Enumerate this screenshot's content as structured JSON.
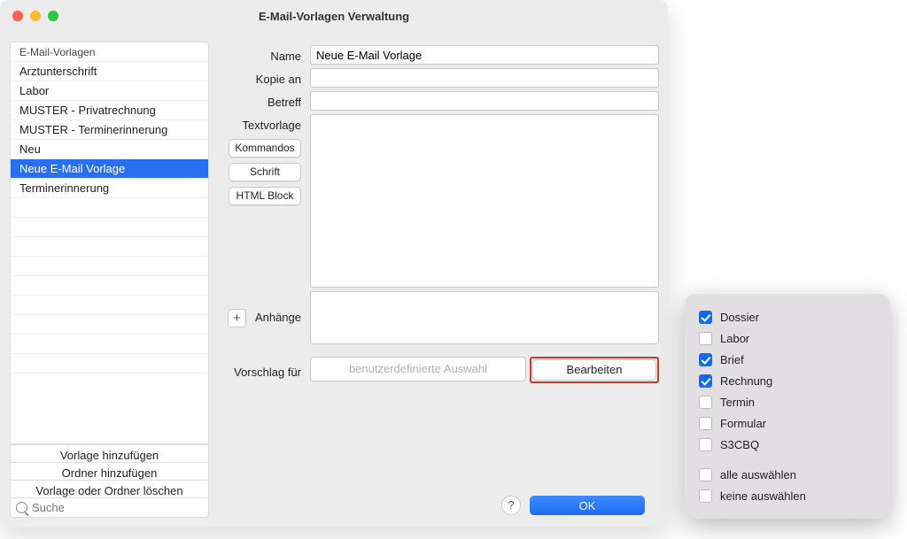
{
  "window": {
    "title": "E-Mail-Vorlagen Verwaltung"
  },
  "sidebar": {
    "folder": "E-Mail-Vorlagen",
    "templates": [
      {
        "label": "Arztunterschrift",
        "selected": false
      },
      {
        "label": "Labor",
        "selected": false
      },
      {
        "label": "MUSTER - Privatrechnung",
        "selected": false
      },
      {
        "label": "MUSTER - Terminerinnerung",
        "selected": false
      },
      {
        "label": "Neu",
        "selected": false
      },
      {
        "label": "Neue E-Mail Vorlage",
        "selected": true
      },
      {
        "label": "Terminerinnerung",
        "selected": false
      }
    ],
    "actions": {
      "add_template": "Vorlage hinzufügen",
      "add_folder": "Ordner hinzufügen",
      "delete": "Vorlage oder Ordner löschen"
    },
    "search_placeholder": "Suche"
  },
  "form": {
    "labels": {
      "name": "Name",
      "copy_to": "Kopie an",
      "subject": "Betreff",
      "texttemplate": "Textvorlage",
      "attachments": "Anhänge",
      "suggestion_for": "Vorschlag für"
    },
    "values": {
      "name": "Neue E-Mail Vorlage",
      "copy_to": "",
      "subject": "",
      "suggestion_text": "benutzerdefinierte Auswahl"
    },
    "side_buttons": {
      "commands": "Kommandos",
      "font": "Schrift",
      "html_block": "HTML Block"
    },
    "edit_button": "Bearbeiten"
  },
  "footer": {
    "help": "?",
    "ok": "OK"
  },
  "popover": {
    "options": [
      {
        "label": "Dossier",
        "checked": true
      },
      {
        "label": "Labor",
        "checked": false
      },
      {
        "label": "Brief",
        "checked": true
      },
      {
        "label": "Rechnung",
        "checked": true
      },
      {
        "label": "Termin",
        "checked": false
      },
      {
        "label": "Formular",
        "checked": false
      },
      {
        "label": "S3CBQ",
        "checked": false
      }
    ],
    "select_all": "alle auswählen",
    "select_none": "keine auswählen"
  }
}
